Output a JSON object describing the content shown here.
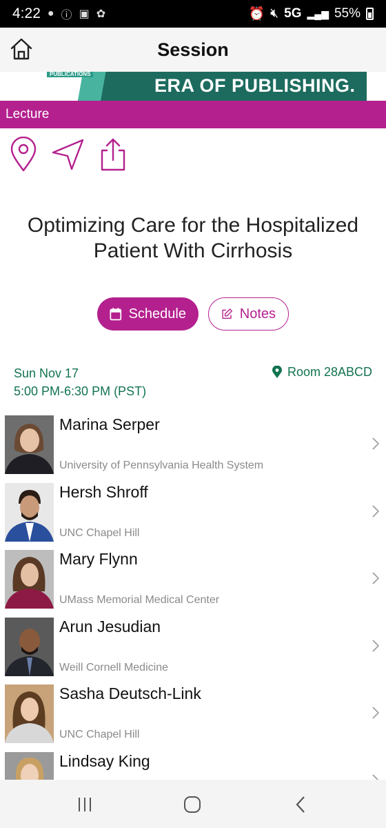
{
  "status_bar": {
    "time": "4:22",
    "network": "5G",
    "battery": "55%"
  },
  "header": {
    "title": "Session"
  },
  "banner": {
    "small_text": "PUBLICATIONS",
    "text": "ERA OF PUBLISHING."
  },
  "category": "Lecture",
  "session": {
    "title": "Optimizing Care for the Hospitalized Patient With Cirrhosis",
    "date": "Sun Nov 17",
    "time": "5:00 PM-6:30 PM (PST)",
    "room": "Room 28ABCD"
  },
  "buttons": {
    "schedule": "Schedule",
    "notes": "Notes"
  },
  "speakers": [
    {
      "name": "Marina Serper",
      "org": "University of Pennsylvania Health System"
    },
    {
      "name": "Hersh Shroff",
      "org": "UNC Chapel Hill"
    },
    {
      "name": "Mary Flynn",
      "org": "UMass Memorial Medical Center"
    },
    {
      "name": "Arun Jesudian",
      "org": "Weill Cornell Medicine"
    },
    {
      "name": "Sasha Deutsch-Link",
      "org": "UNC Chapel Hill"
    },
    {
      "name": "Lindsay King",
      "org": ""
    }
  ],
  "colors": {
    "accent": "#b4208e",
    "info_green": "#12734f",
    "banner_teal": "#1c6b5e"
  }
}
